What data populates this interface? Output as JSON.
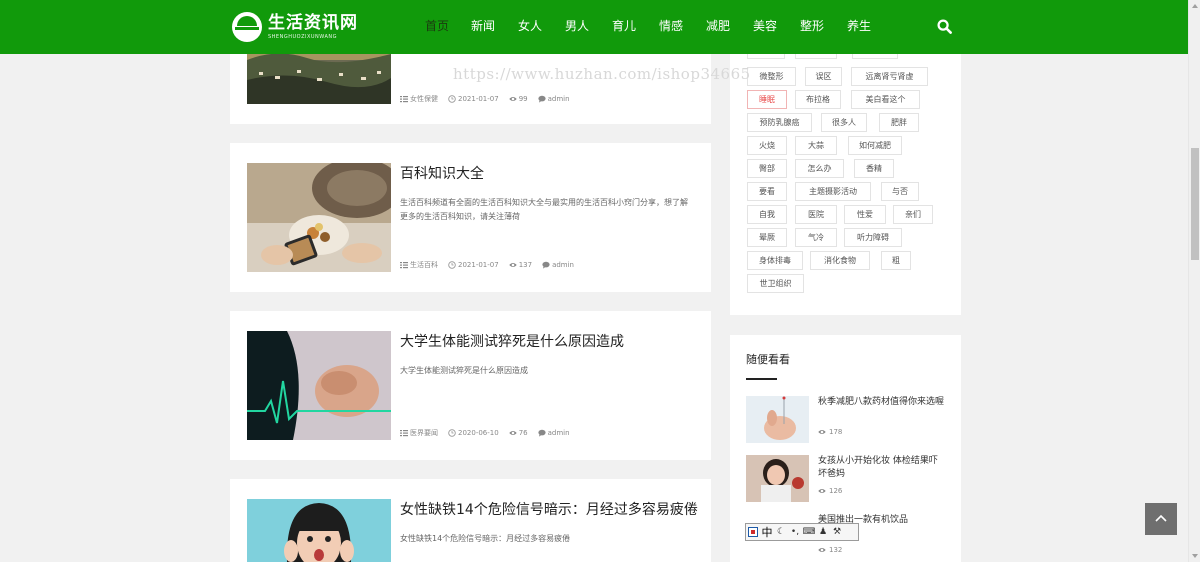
{
  "header": {
    "logo_title": "生活资讯网",
    "logo_subtitle": "SHENGHUOZIXUNWANG",
    "nav": [
      "首页",
      "新闻",
      "女人",
      "男人",
      "育儿",
      "情感",
      "减肥",
      "美容",
      "整形",
      "养生"
    ],
    "active_nav": "首页",
    "brand_color": "#119a0b"
  },
  "watermark": "https://www.huzhan.com/ishop34665",
  "articles": [
    {
      "title": "",
      "desc": "",
      "category": "女性保健",
      "date": "2021-01-07",
      "views": "99",
      "author": "admin"
    },
    {
      "title": "百科知识大全",
      "desc": "生活百科频道有全面的生活百科知识大全与最实用的生活百科小窍门分享，想了解更多的生活百科知识，请关注薄荷",
      "category": "生活百科",
      "date": "2021-01-07",
      "views": "137",
      "author": "admin"
    },
    {
      "title": "大学生体能测试猝死是什么原因造成",
      "desc": "大学生体能测试猝死是什么原因造成",
      "category": "医界要闻",
      "date": "2020-06-10",
      "views": "76",
      "author": "admin"
    },
    {
      "title": "女性缺铁14个危险信号暗示：月经过多容易疲倦",
      "desc": "女性缺铁14个危险信号暗示：月经过多容易疲倦",
      "category": "",
      "date": "",
      "views": "",
      "author": ""
    }
  ],
  "tags": [
    "微整形",
    "误区",
    "远离肾亏肾虚",
    "睡眠",
    "布拉格",
    "美白看这个",
    "预防乳腺癌",
    "很多人",
    "肥胖",
    "火烧",
    "大蒜",
    "如何减肥",
    "臀部",
    "怎么办",
    "香精",
    "要看",
    "主题摄影活动",
    "与否",
    "自我",
    "医院",
    "性爱",
    "亲们",
    "晕厥",
    "气冷",
    "听力障碍",
    "身体排毒",
    "消化食物",
    "粗",
    "世卫组织"
  ],
  "hot_tag": "睡眠",
  "random": {
    "heading": "随便看看",
    "items": [
      {
        "title": "秋季减肥八款药材值得你来选喔",
        "views": "178"
      },
      {
        "title": "女孩从小开始化妆 体检结果吓坏爸妈",
        "views": "126"
      },
      {
        "title": "美国推出一款有机饮品",
        "views": "132"
      }
    ]
  },
  "ime": {
    "mode": "中",
    "punct": "•,"
  },
  "icons": {
    "search": "search-icon",
    "category": "list-icon",
    "date": "clock-icon",
    "views": "eye-icon",
    "author": "comment-icon",
    "back_to_top": "arrow-up-icon"
  }
}
